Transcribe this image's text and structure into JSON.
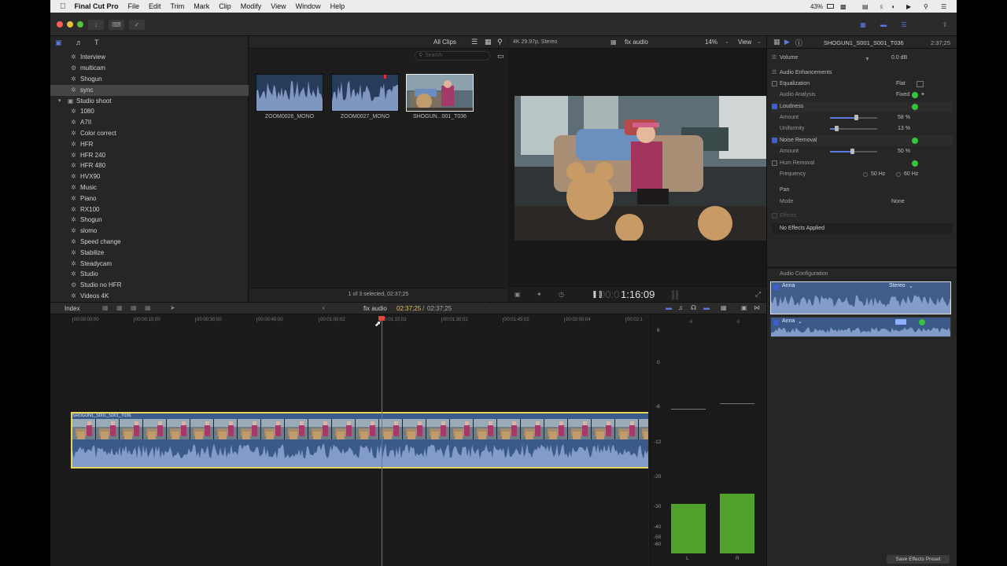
{
  "menubar": {
    "app": "Final Cut Pro",
    "items": [
      "File",
      "Edit",
      "Trim",
      "Mark",
      "Clip",
      "Modify",
      "View",
      "Window",
      "Help"
    ],
    "status_battery": "43%"
  },
  "library": {
    "items": [
      {
        "label": "Interview",
        "kind": "keyword"
      },
      {
        "label": "multicam",
        "kind": "smart"
      },
      {
        "label": "Shogun",
        "kind": "keyword"
      },
      {
        "label": "sync",
        "kind": "keyword",
        "selected": true
      },
      {
        "label": "Studio shoot",
        "kind": "event"
      },
      {
        "label": "1080",
        "kind": "keyword"
      },
      {
        "label": "A7II",
        "kind": "keyword"
      },
      {
        "label": "Color correct",
        "kind": "keyword"
      },
      {
        "label": "HFR",
        "kind": "keyword"
      },
      {
        "label": "HFR 240",
        "kind": "keyword"
      },
      {
        "label": "HFR 480",
        "kind": "keyword"
      },
      {
        "label": "HVX90",
        "kind": "keyword"
      },
      {
        "label": "Music",
        "kind": "keyword"
      },
      {
        "label": "Piano",
        "kind": "keyword"
      },
      {
        "label": "RX100",
        "kind": "keyword"
      },
      {
        "label": "Shogun",
        "kind": "keyword"
      },
      {
        "label": "slomo",
        "kind": "keyword"
      },
      {
        "label": "Speed change",
        "kind": "keyword"
      },
      {
        "label": "Stabilize",
        "kind": "keyword"
      },
      {
        "label": "Steadycam",
        "kind": "keyword"
      },
      {
        "label": "Studio",
        "kind": "keyword"
      },
      {
        "label": "Studio no HFR",
        "kind": "smart"
      },
      {
        "label": "Videos 4K",
        "kind": "keyword"
      }
    ]
  },
  "browser": {
    "filter": "All Clips",
    "search_placeholder": "Search",
    "clips": [
      {
        "name": "ZOOM0026_MONO"
      },
      {
        "name": "ZOOM0027_MONO"
      },
      {
        "name": "SHOGUN...001_T036"
      }
    ],
    "status": "1 of 3 selected, 02:37;25"
  },
  "viewer": {
    "format": "4K 29.97p, Stereo",
    "project": "fix audio",
    "zoom": "14%",
    "view_label": "View",
    "timecode_dim": "00:0",
    "timecode": "1:16:09"
  },
  "inspector": {
    "clip_title": "SHOGUN1_S001_S001_T036",
    "clip_duration": "2:37;25",
    "volume_label": "Volume",
    "volume_value": "0.0 dB",
    "audio_enhancements": "Audio Enhancements",
    "equalization": "Equalization",
    "equalization_value": "Flat",
    "audio_analysis": "Audio Analysis",
    "audio_analysis_value": "Fixed",
    "loudness": "Loudness",
    "amount": "Amount",
    "loudness_amount": "58 %",
    "uniformity": "Uniformity",
    "uniformity_value": "13 %",
    "noise_removal": "Noise Removal",
    "noise_amount": "50 %",
    "hum_removal": "Hum Removal",
    "frequency": "Frequency",
    "freq_50": "50 Hz",
    "freq_60": "60 Hz",
    "pan": "Pan",
    "mode": "Mode",
    "mode_value": "None",
    "effects": "Effects",
    "no_effects": "No Effects Applied",
    "audio_configuration": "Audio Configuration",
    "channel1": "Anna",
    "channel1_type": "Stereo",
    "channel2": "Anna",
    "save_preset": "Save Effects Preset"
  },
  "timeline": {
    "index": "Index",
    "project": "fix audio",
    "position": "02:37;25",
    "duration": "02:37;25",
    "ruler": [
      "00:00:00;00",
      "00:00:15;00",
      "00:00:30;00",
      "00:00:45;00",
      "00:01:00;02",
      "00:01:15;02",
      "00:01:30;02",
      "00:01:45;02",
      "00:02:00;04",
      "00:02:1"
    ],
    "clip_name": "SHOGUN1_S001_S001_T036"
  },
  "meters": {
    "scale": [
      "6",
      "0",
      "-6",
      "-12",
      "-20",
      "-30",
      "-40",
      "-50",
      "-60"
    ],
    "channels": [
      "L",
      "R"
    ],
    "peak_labels": [
      "-6",
      "-6"
    ]
  }
}
